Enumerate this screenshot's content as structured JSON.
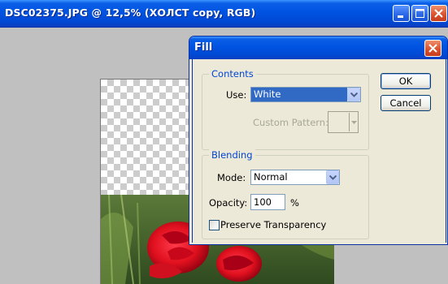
{
  "document_window": {
    "title": "DSC02375.JPG @ 12,5% (ХОЛСТ copy, RGB)"
  },
  "dialog": {
    "title": "Fill",
    "contents": {
      "legend": "Contents",
      "use_label": "Use:",
      "use_value": "White",
      "custom_pattern_label": "Custom Pattern:"
    },
    "blending": {
      "legend": "Blending",
      "mode_label": "Mode:",
      "mode_value": "Normal",
      "opacity_label": "Opacity:",
      "opacity_value": "100",
      "opacity_unit": "%",
      "preserve_transparency_label": "Preserve Transparency",
      "preserve_transparency_checked": false
    },
    "buttons": {
      "ok": "OK",
      "cancel": "Cancel"
    }
  },
  "colors": {
    "titlebar_blue": "#0053e1",
    "dialog_bg": "#ece9d8",
    "group_label": "#0046d5",
    "selection": "#316ac5"
  }
}
